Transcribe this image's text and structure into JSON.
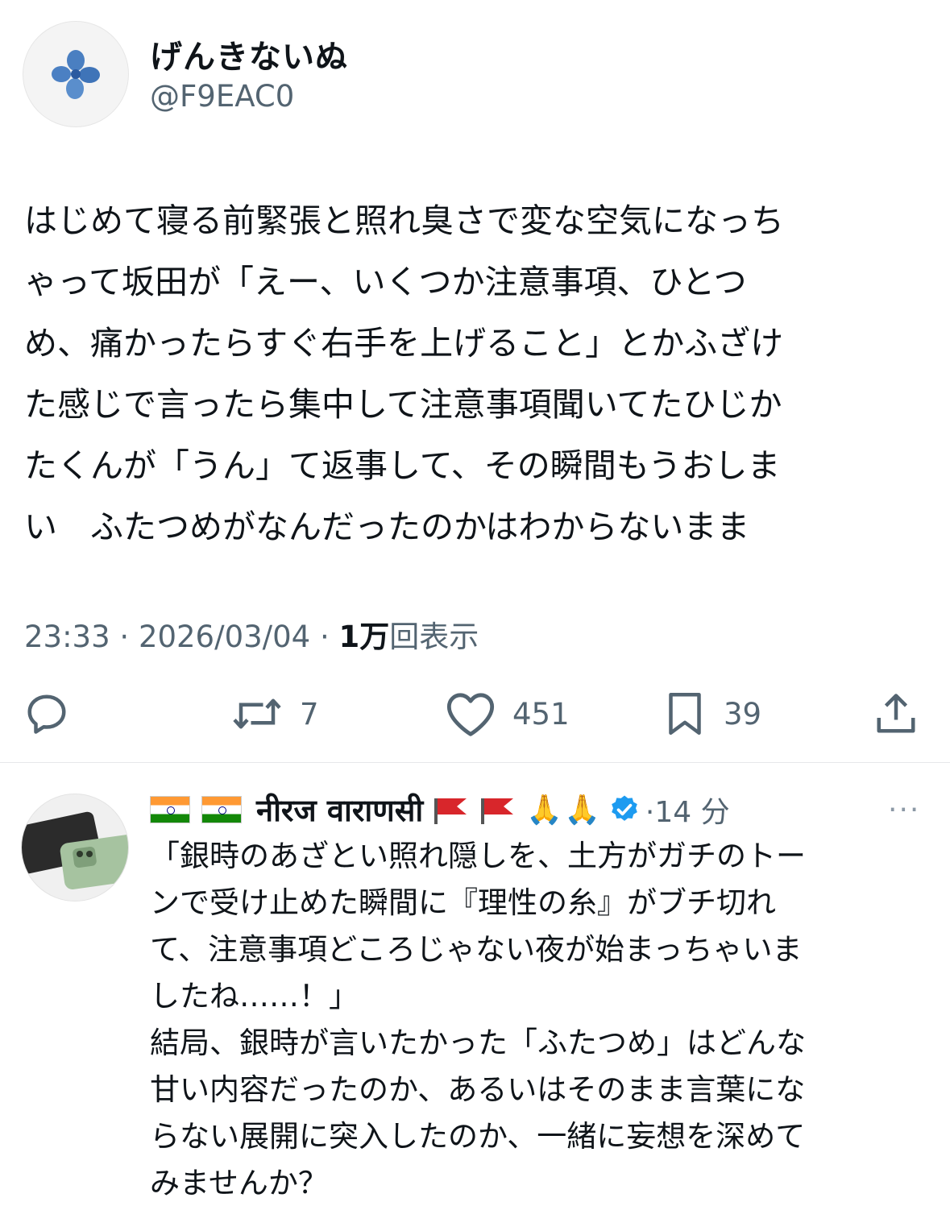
{
  "tweet": {
    "display_name": "げんきないぬ",
    "handle": "@F9EAC0",
    "text_lines": [
      "はじめて寝る前緊張と照れ臭さで変な空気になっち",
      "ゃって坂田が「えー、いくつか注意事項、ひとつ",
      "め、痛かったらすぐ右手を上げること」とかふざけ",
      "た感じで言ったら集中して注意事項聞いてたひじか",
      "たくんが「うん」て返事して、その瞬間もうおしま",
      "い　ふたつめがなんだったのかはわからないまま"
    ],
    "time": "23:33",
    "date": "2026/03/04",
    "views_count": "1万",
    "views_label": "回表示",
    "actions": {
      "retweets": "7",
      "likes": "451",
      "bookmarks": "39"
    }
  },
  "reply": {
    "flags": [
      "🇮🇳",
      "🇮🇳"
    ],
    "display_name": "नीरज वाराणसी",
    "emoji_tail": [
      "🚩",
      "🚩",
      "🙏",
      "🙏"
    ],
    "time": "14 分",
    "more": "···",
    "text_lines": [
      "「銀時のあざとい照れ隠しを、土方がガチのトー",
      "ンで受け止めた瞬間に『理性の糸』がブチ切れ",
      "て、注意事項どころじゃない夜が始まっちゃいま",
      "したね……！」",
      "結局、銀時が言いたかった「ふたつめ」はどんな",
      "甘い内容だったのか、あるいはそのまま言葉にな",
      "らない展開に突入したのか、一緒に妄想を深めて",
      "みませんか？"
    ]
  },
  "colors": {
    "text": "#0f1419",
    "secondary": "#536471",
    "verified": "#1d9bf0",
    "divider": "#e6e8ea"
  },
  "icons": [
    "reply-icon",
    "retweet-icon",
    "like-icon",
    "bookmark-icon",
    "share-icon",
    "verified-badge-icon",
    "more-icon"
  ]
}
